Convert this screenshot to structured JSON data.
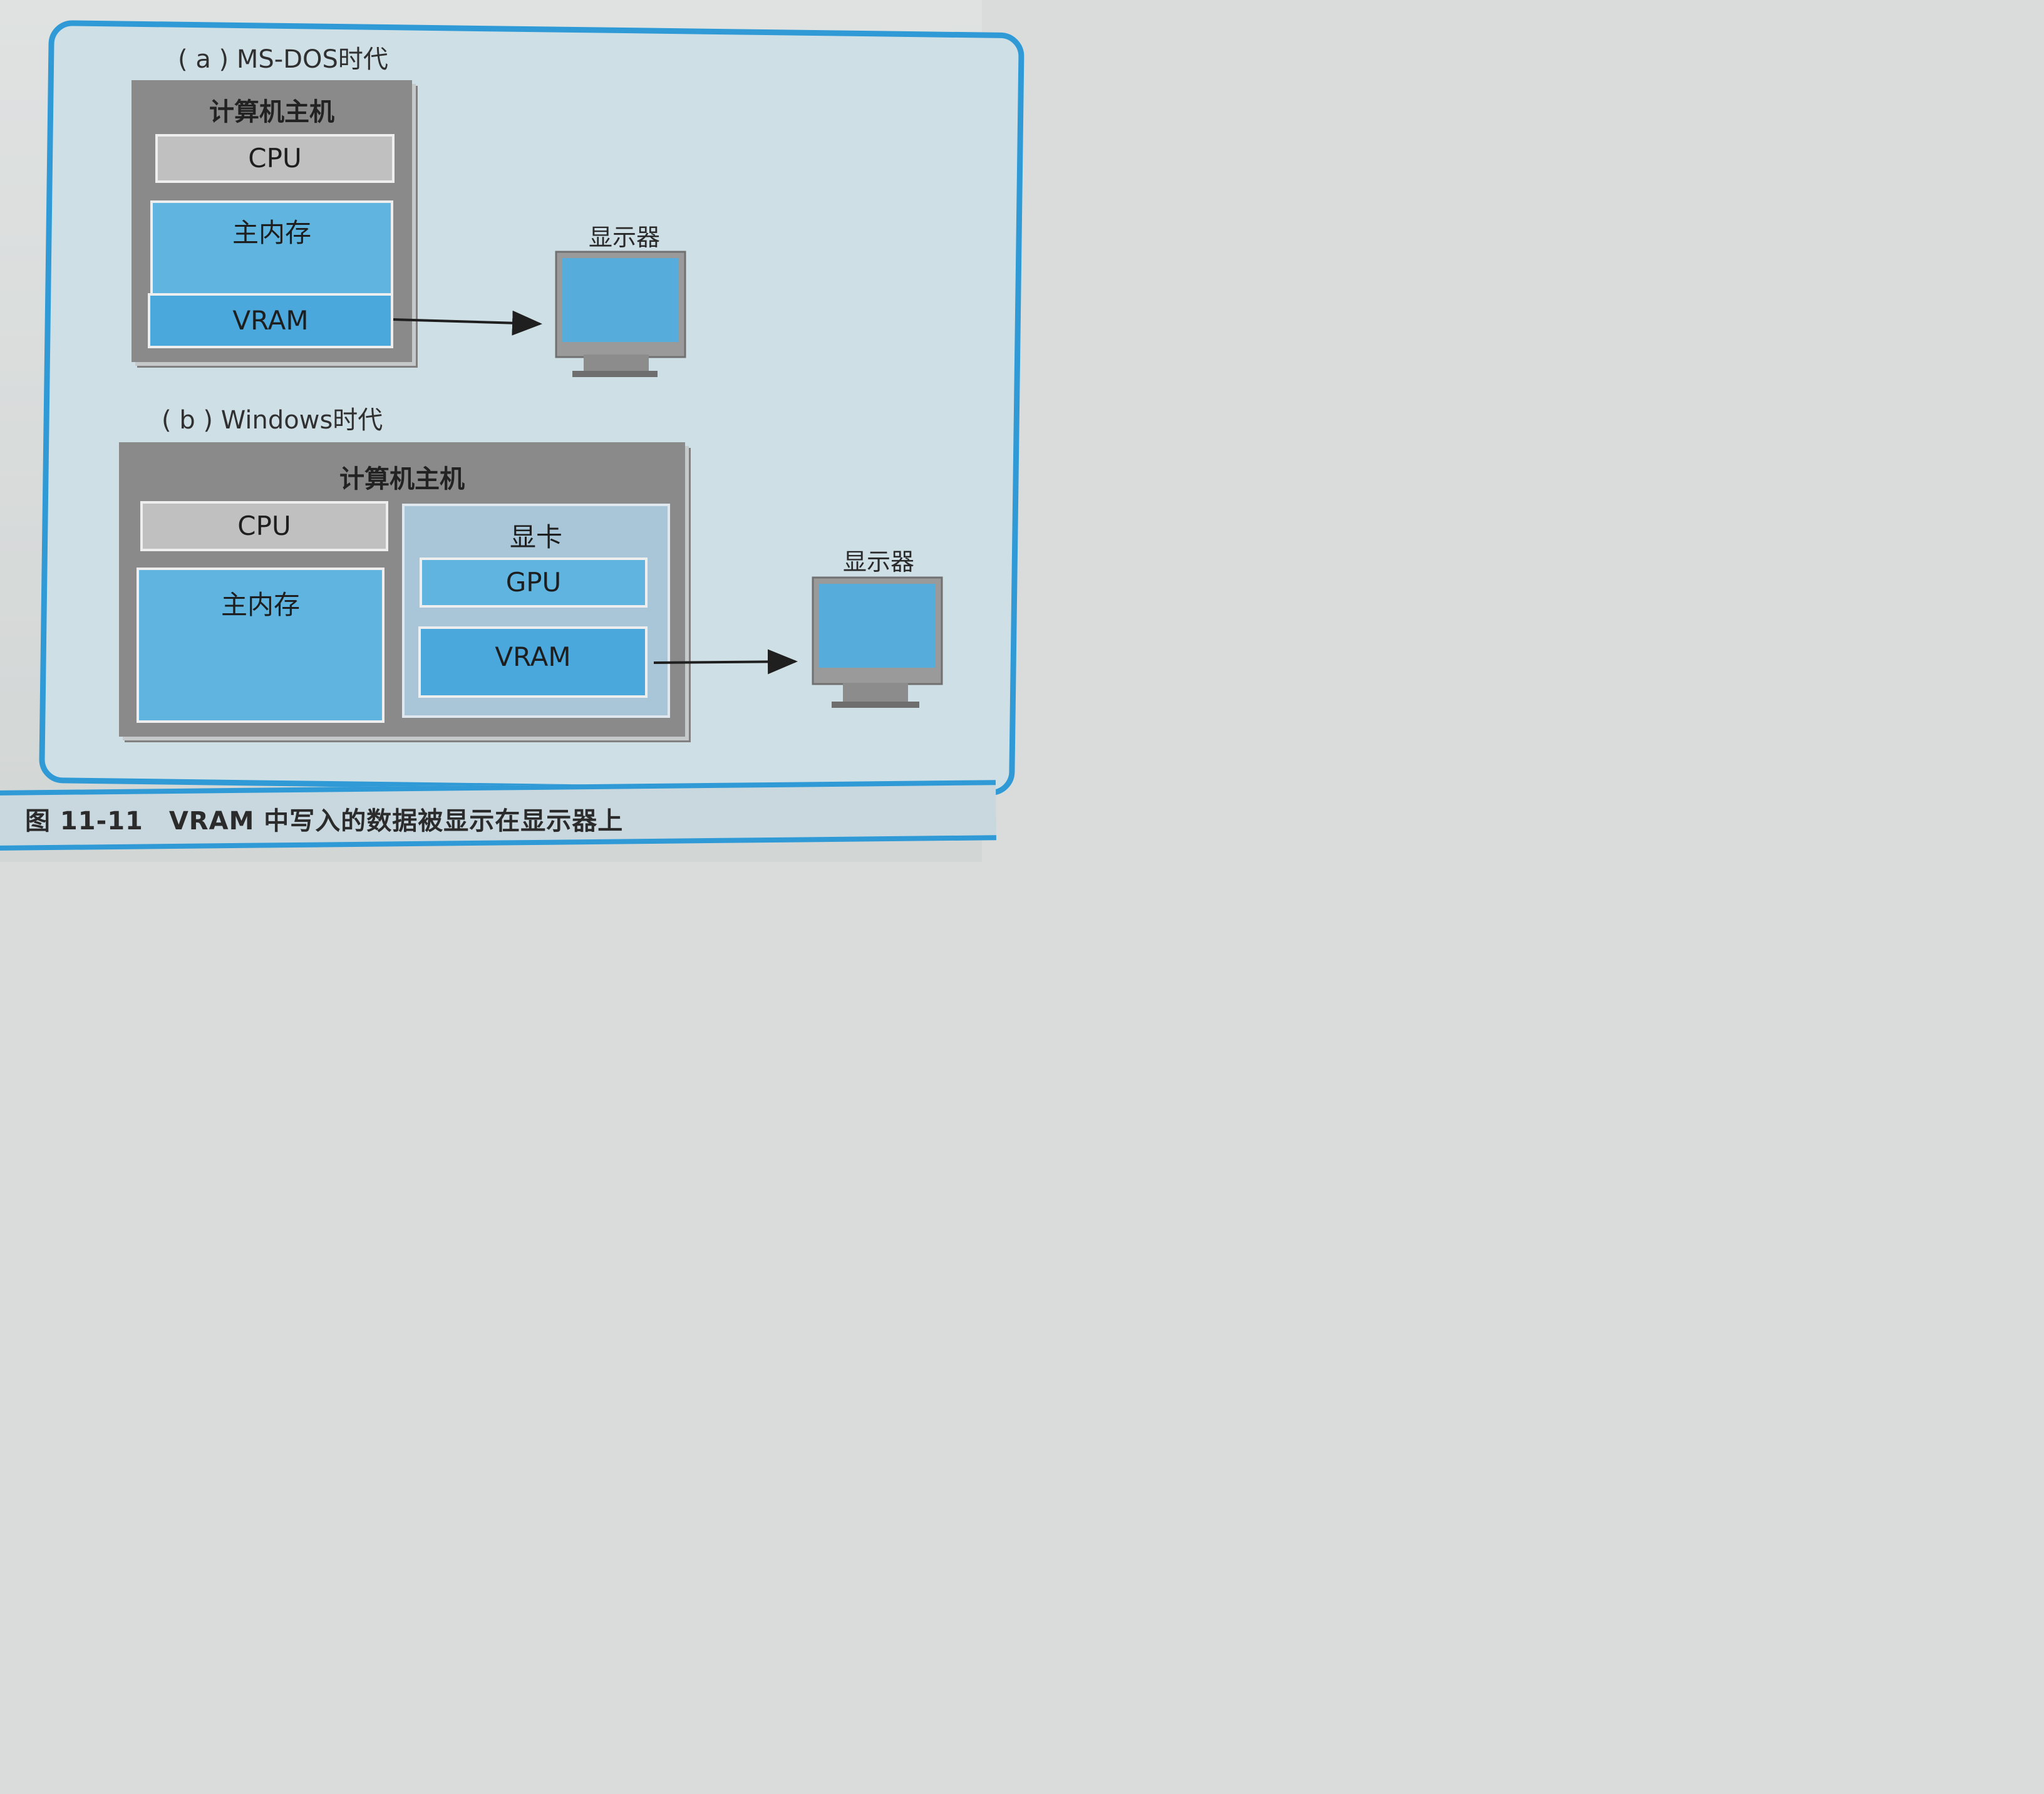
{
  "figure": {
    "caption": "图 11-11　VRAM 中写入的数据被显示在显示器上"
  },
  "section_a": {
    "title": "( a ) MS-DOS时代",
    "host_label": "计算机主机",
    "cpu_label": "CPU",
    "main_memory_label": "主内存",
    "vram_label": "VRAM",
    "monitor_label": "显示器"
  },
  "section_b": {
    "title": "( b ) Windows时代",
    "host_label": "计算机主机",
    "cpu_label": "CPU",
    "main_memory_label": "主内存",
    "graphics_card_label": "显卡",
    "gpu_label": "GPU",
    "vram_label": "VRAM",
    "monitor_label": "显示器"
  },
  "colors": {
    "frame_blue": "#2f9ad6",
    "host_gray": "#8a8a8a",
    "cpu_gray": "#c0c0c0",
    "memory_blue": "#5fb4e0",
    "vram_blue": "#4aa8dc",
    "screen_blue": "#56addc"
  }
}
